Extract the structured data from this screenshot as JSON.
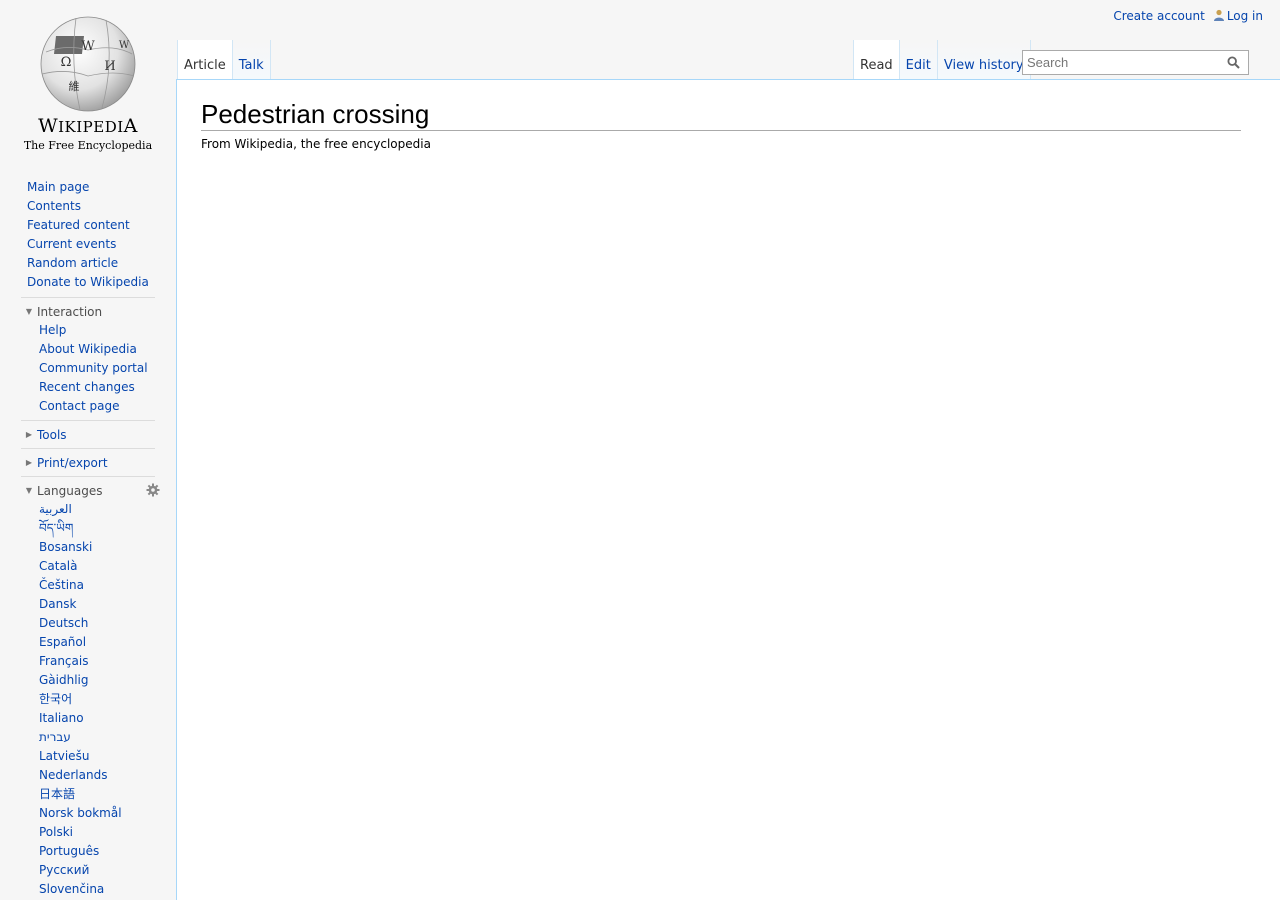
{
  "personal": {
    "create_account": "Create account",
    "log_in": "Log in"
  },
  "logo": {
    "wordmark_big_w": "W",
    "wordmark_mid": "IKIPEDI",
    "wordmark_end": "A",
    "tagline": "The Free Encyclopedia"
  },
  "nav_main": [
    "Main page",
    "Contents",
    "Featured content",
    "Current events",
    "Random article",
    "Donate to Wikipedia"
  ],
  "interaction": {
    "heading": "Interaction",
    "items": [
      "Help",
      "About Wikipedia",
      "Community portal",
      "Recent changes",
      "Contact page"
    ]
  },
  "tools": {
    "heading": "Tools"
  },
  "print_export": {
    "heading": "Print/export"
  },
  "languages": {
    "heading": "Languages",
    "items": [
      "العربية",
      "བོད་ཡིག",
      "Bosanski",
      "Català",
      "Čeština",
      "Dansk",
      "Deutsch",
      "Español",
      "Français",
      "Gàidhlig",
      "한국어",
      "Italiano",
      "עברית",
      "Latviešu",
      "Nederlands",
      "日本語",
      "Norsk bokmål",
      "Polski",
      "Português",
      "Русский",
      "Slovenčina"
    ]
  },
  "tabs": {
    "article": "Article",
    "talk": "Talk",
    "read": "Read",
    "edit": "Edit",
    "history": "View history"
  },
  "search": {
    "placeholder": "Search"
  },
  "article": {
    "title": "Pedestrian crossing",
    "site_sub": "From Wikipedia, the free encyclopedia"
  },
  "colors": {
    "link": "#0645ad",
    "border": "#a7d7f9",
    "background": "#f6f6f6"
  }
}
